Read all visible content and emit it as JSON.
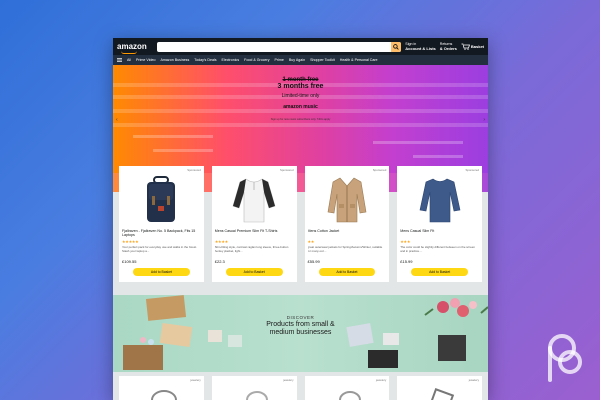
{
  "colors": {
    "accent": "#ff9900",
    "button": "#ffd814",
    "nav": "#131921"
  },
  "header": {
    "logo": "amazon",
    "search_placeholder": "",
    "signin_line1": "Sign in",
    "signin_line2": "Account & Lists",
    "returns_line1": "Returns",
    "returns_line2": "& Orders",
    "basket": "Basket"
  },
  "nav": {
    "items": [
      "All",
      "Prime Video",
      "Amazon Business",
      "Today's Deals",
      "Electronics",
      "Food & Grocery",
      "Prime",
      "Buy Again",
      "Shopper Toolkit",
      "Health & Personal Care"
    ]
  },
  "hero": {
    "strike": "1 month free",
    "headline": "3 months free",
    "sub": "Limited-time only",
    "brand": "amazon music",
    "fine": "Sign up for new music subscribers only. T&Cs apply"
  },
  "cards": [
    {
      "sponsored": "Sponsored",
      "title": "Fjallraven - Fjallraven No. 5 Backpack, Fits 15 Laptops",
      "stars": "★★★★★",
      "desc": "Your perfect pack for everyday use and walks in the forest. Stash your laptop a...",
      "price": "£109.55",
      "button": "Add to Basket"
    },
    {
      "sponsored": "Sponsored",
      "title": "Mens Casual Premium Slim Fit T-Shirts",
      "stars": "★★★★",
      "desc": "Slim-fitting style, contrast raglan long sleeve, three-button henley placket, light...",
      "price": "£22.3",
      "button": "Add to Basket"
    },
    {
      "sponsored": "Sponsored",
      "title": "Mens Cotton Jacket",
      "stars": "★★",
      "desc": "great outerwear jackets for Spring/Autumn/Winter, suitable for many occ...",
      "price": "£55.99",
      "button": "Add to Basket"
    },
    {
      "sponsored": "Sponsored",
      "title": "Mens Casual Slim Fit",
      "stars": "★★★",
      "desc": "The color could be slightly different between on the screen and in practice....",
      "price": "£15.99",
      "button": "Add to Basket"
    }
  ],
  "discover": {
    "label": "DISCOVER",
    "headline": "Products from small & medium businesses"
  },
  "bottom_cards": [
    {
      "sponsored": "jewelery"
    },
    {
      "sponsored": "jewelery"
    },
    {
      "sponsored": "jewelery"
    },
    {
      "sponsored": "jewelery"
    }
  ]
}
